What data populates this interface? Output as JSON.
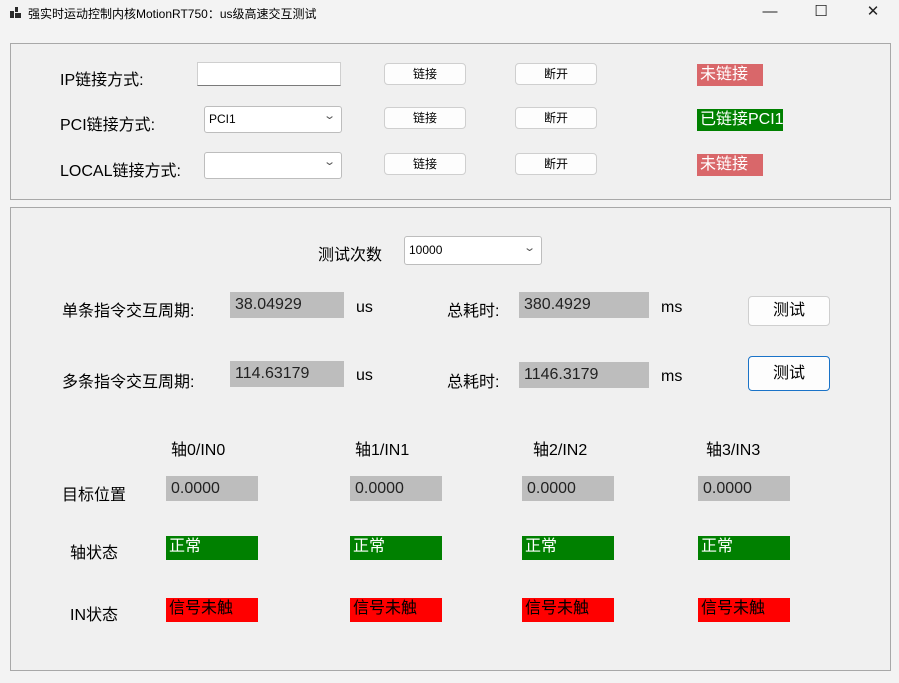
{
  "window": {
    "title": "强实时运动控制内核MotionRT750：us级高速交互测试",
    "minimize": "—",
    "maximize": "☐",
    "close": "✕"
  },
  "connection": {
    "ip_label": "IP链接方式:",
    "ip_value": "",
    "pci_label": "PCI链接方式:",
    "pci_value": "PCI1",
    "local_label": "LOCAL链接方式:",
    "local_value": "",
    "connect": "链接",
    "disconnect": "断开",
    "ip_status": "未链接",
    "pci_status": "已链接PCI1",
    "local_status": "未链接"
  },
  "test": {
    "count_label": "测试次数",
    "count_value": "10000",
    "single_label": "单条指令交互周期:",
    "single_value": "38.04929",
    "multi_label": "多条指令交互周期:",
    "multi_value": "114.63179",
    "unit_us": "us",
    "total_label": "总耗时:",
    "single_total": "380.4929",
    "multi_total": "1146.3179",
    "unit_ms": "ms",
    "test_button": "测试"
  },
  "axes": {
    "headers": [
      "轴0/IN0",
      "轴1/IN1",
      "轴2/IN2",
      "轴3/IN3"
    ],
    "row_target": "目标位置",
    "row_axis_state": "轴状态",
    "row_in_state": "IN状态",
    "targets": [
      "0.0000",
      "0.0000",
      "0.0000",
      "0.0000"
    ],
    "axis_states": [
      "正常",
      "正常",
      "正常",
      "正常"
    ],
    "in_states": [
      "信号未触",
      "信号未触",
      "信号未触",
      "信号未触"
    ]
  },
  "colors": {
    "not_connected": "#d9676a",
    "connected": "#008000",
    "signal_off": "#ff0000",
    "readout_bg": "#bdbdbd"
  }
}
